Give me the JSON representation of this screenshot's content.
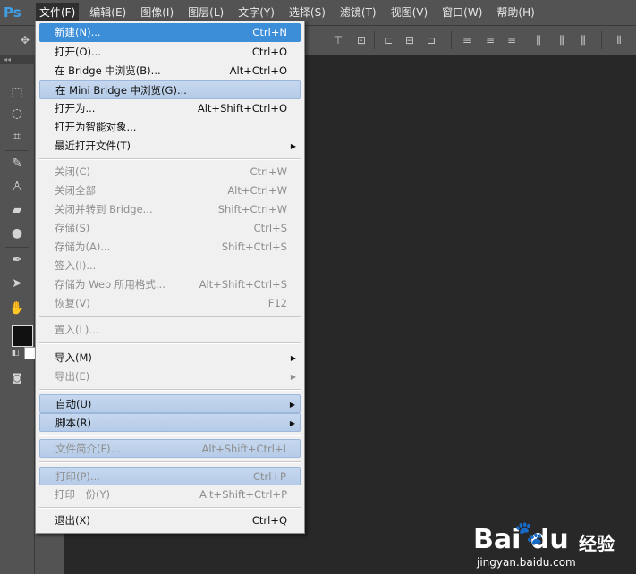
{
  "app": {
    "logo": "Ps"
  },
  "menubar": {
    "items": [
      "文件(F)",
      "编辑(E)",
      "图像(I)",
      "图层(L)",
      "文字(Y)",
      "选择(S)",
      "滤镜(T)",
      "视图(V)",
      "窗口(W)",
      "帮助(H)"
    ]
  },
  "file_menu": {
    "items": [
      {
        "label": "新建(N)...",
        "shortcut": "Ctrl+N"
      },
      {
        "label": "打开(O)...",
        "shortcut": "Ctrl+O"
      },
      {
        "label": "在 Bridge 中浏览(B)...",
        "shortcut": "Alt+Ctrl+O"
      },
      {
        "label": "在 Mini Bridge 中浏览(G)...",
        "shortcut": ""
      },
      {
        "label": "打开为...",
        "shortcut": "Alt+Shift+Ctrl+O"
      },
      {
        "label": "打开为智能对象...",
        "shortcut": ""
      },
      {
        "label": "最近打开文件(T)",
        "shortcut": ""
      },
      {
        "label": "关闭(C)",
        "shortcut": "Ctrl+W"
      },
      {
        "label": "关闭全部",
        "shortcut": "Alt+Ctrl+W"
      },
      {
        "label": "关闭并转到 Bridge...",
        "shortcut": "Shift+Ctrl+W"
      },
      {
        "label": "存储(S)",
        "shortcut": "Ctrl+S"
      },
      {
        "label": "存储为(A)...",
        "shortcut": "Shift+Ctrl+S"
      },
      {
        "label": "签入(I)...",
        "shortcut": ""
      },
      {
        "label": "存储为 Web 所用格式...",
        "shortcut": "Alt+Shift+Ctrl+S"
      },
      {
        "label": "恢复(V)",
        "shortcut": "F12"
      },
      {
        "label": "置入(L)...",
        "shortcut": ""
      },
      {
        "label": "导入(M)",
        "shortcut": ""
      },
      {
        "label": "导出(E)",
        "shortcut": ""
      },
      {
        "label": "自动(U)",
        "shortcut": ""
      },
      {
        "label": "脚本(R)",
        "shortcut": ""
      },
      {
        "label": "文件简介(F)...",
        "shortcut": "Alt+Shift+Ctrl+I"
      },
      {
        "label": "打印(P)...",
        "shortcut": "Ctrl+P"
      },
      {
        "label": "打印一份(Y)",
        "shortcut": "Alt+Shift+Ctrl+P"
      },
      {
        "label": "退出(X)",
        "shortcut": "Ctrl+Q"
      }
    ]
  },
  "watermark": {
    "logo": "Bai du",
    "jingyan": "经验",
    "url": "jingyan.baidu.com"
  },
  "colors": {
    "menu_highlight": "#3d8ed9",
    "ps_blue": "#3fa0e8"
  }
}
